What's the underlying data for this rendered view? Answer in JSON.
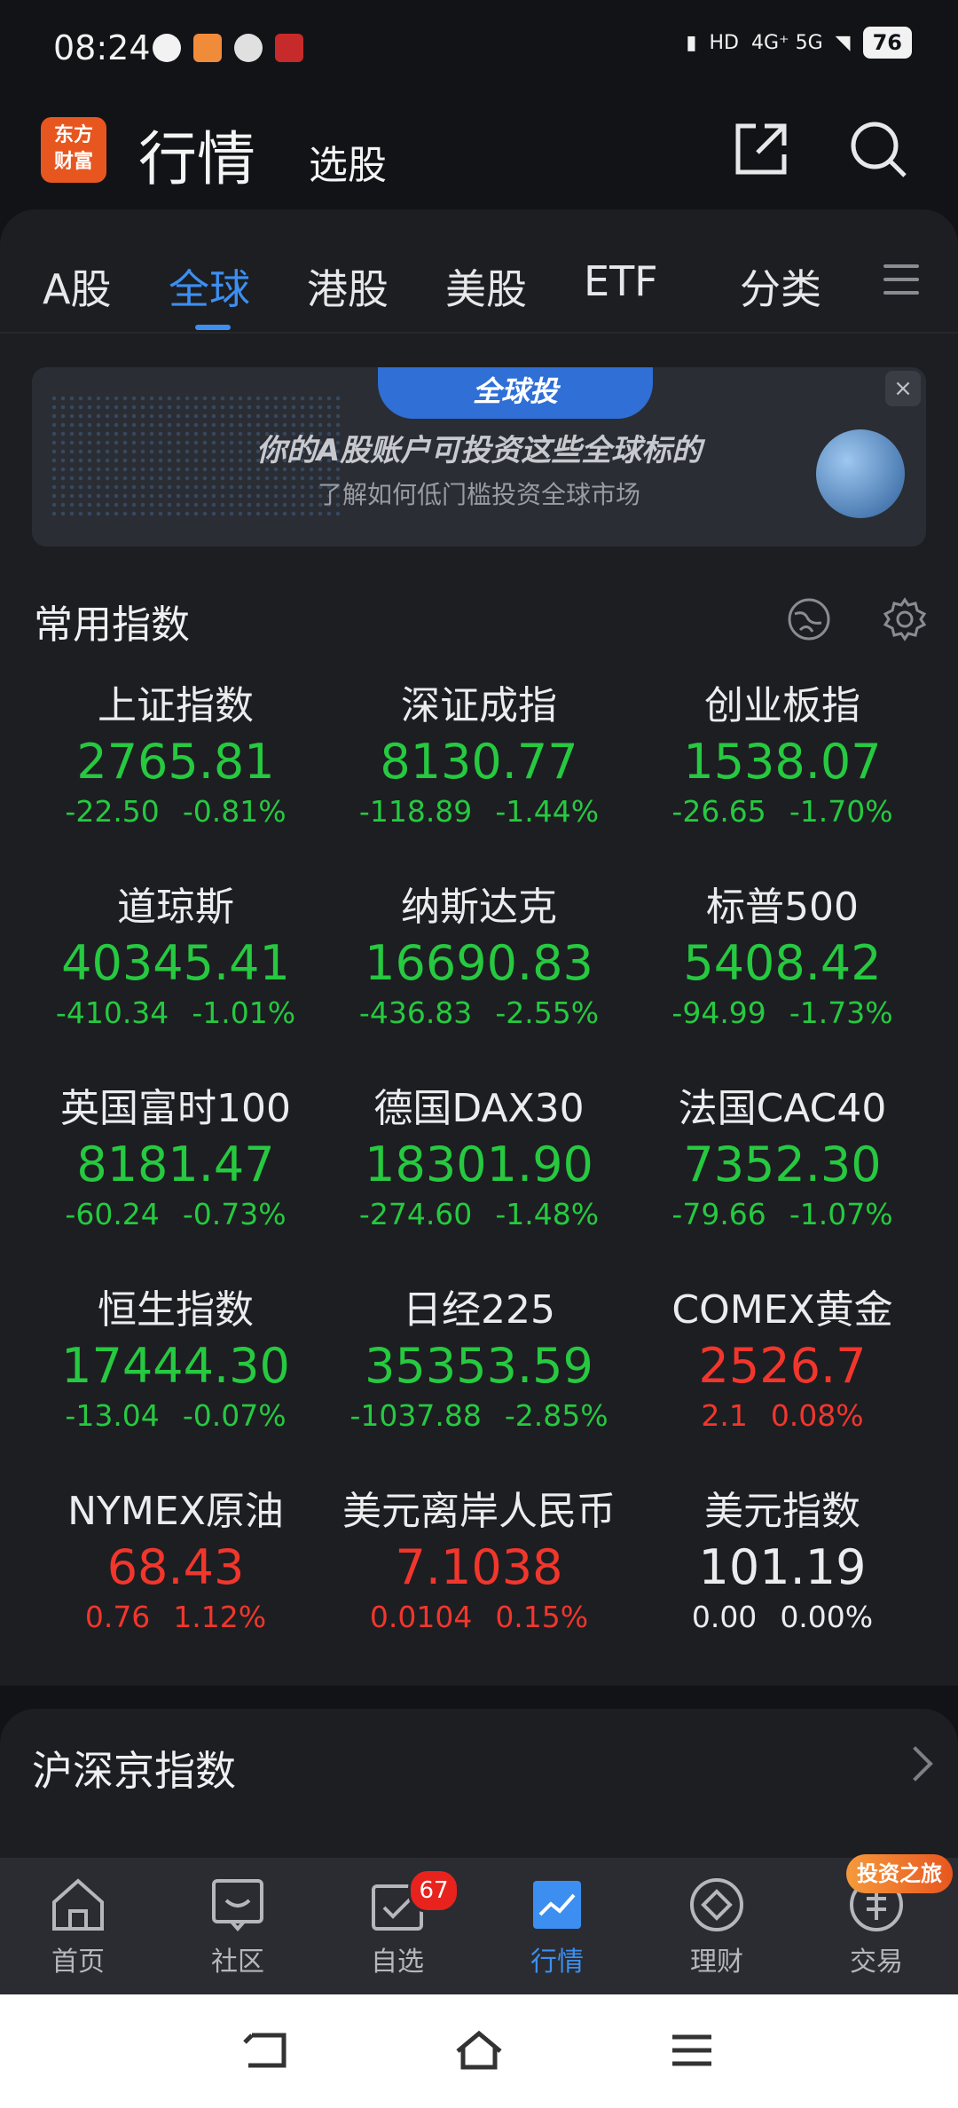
{
  "status_bar": {
    "time": "08:24",
    "network": "4G⁺ 5G",
    "battery": "76"
  },
  "header": {
    "logo_line1": "东方",
    "logo_line2": "财富",
    "title": "行情",
    "subtitle": "选股"
  },
  "tabs": [
    "A股",
    "全球",
    "港股",
    "美股",
    "ETF",
    "分类"
  ],
  "active_tab": "全球",
  "banner": {
    "badge": "全球投",
    "headline": "你的A股账户可投资这些全球标的",
    "subline": "了解如何低门槛投资全球市场",
    "close": "×"
  },
  "section_common": {
    "title": "常用指数"
  },
  "indices": [
    {
      "name": "上证指数",
      "price": "2765.81",
      "chg": "-22.50",
      "pct": "-0.81%",
      "dir": "down"
    },
    {
      "name": "深证成指",
      "price": "8130.77",
      "chg": "-118.89",
      "pct": "-1.44%",
      "dir": "down"
    },
    {
      "name": "创业板指",
      "price": "1538.07",
      "chg": "-26.65",
      "pct": "-1.70%",
      "dir": "down"
    },
    {
      "name": "道琼斯",
      "price": "40345.41",
      "chg": "-410.34",
      "pct": "-1.01%",
      "dir": "down"
    },
    {
      "name": "纳斯达克",
      "price": "16690.83",
      "chg": "-436.83",
      "pct": "-2.55%",
      "dir": "down"
    },
    {
      "name": "标普500",
      "price": "5408.42",
      "chg": "-94.99",
      "pct": "-1.73%",
      "dir": "down"
    },
    {
      "name": "英国富时100",
      "price": "8181.47",
      "chg": "-60.24",
      "pct": "-0.73%",
      "dir": "down"
    },
    {
      "name": "德国DAX30",
      "price": "18301.90",
      "chg": "-274.60",
      "pct": "-1.48%",
      "dir": "down"
    },
    {
      "name": "法国CAC40",
      "price": "7352.30",
      "chg": "-79.66",
      "pct": "-1.07%",
      "dir": "down"
    },
    {
      "name": "恒生指数",
      "price": "17444.30",
      "chg": "-13.04",
      "pct": "-0.07%",
      "dir": "down"
    },
    {
      "name": "日经225",
      "price": "35353.59",
      "chg": "-1037.88",
      "pct": "-2.85%",
      "dir": "down"
    },
    {
      "name": "COMEX黄金",
      "price": "2526.7",
      "chg": "2.1",
      "pct": "0.08%",
      "dir": "up"
    },
    {
      "name": "NYMEX原油",
      "price": "68.43",
      "chg": "0.76",
      "pct": "1.12%",
      "dir": "up"
    },
    {
      "name": "美元离岸人民币",
      "price": "7.1038",
      "chg": "0.0104",
      "pct": "0.15%",
      "dir": "up"
    },
    {
      "name": "美元指数",
      "price": "101.19",
      "chg": "0.00",
      "pct": "0.00%",
      "dir": "flat"
    }
  ],
  "section_hsj": {
    "title": "沪深京指数"
  },
  "bottom_nav": [
    {
      "label": "首页",
      "icon": "home-icon"
    },
    {
      "label": "社区",
      "icon": "community-icon"
    },
    {
      "label": "自选",
      "icon": "watchlist-icon",
      "badge": "67"
    },
    {
      "label": "行情",
      "icon": "market-icon"
    },
    {
      "label": "理财",
      "icon": "wealth-icon"
    },
    {
      "label": "交易",
      "icon": "trade-icon"
    }
  ],
  "promo_badge": "投资之旅",
  "colors": {
    "accent": "#3c8ff0",
    "down": "#26c940",
    "up": "#f2362c",
    "brand": "#e8561f"
  }
}
